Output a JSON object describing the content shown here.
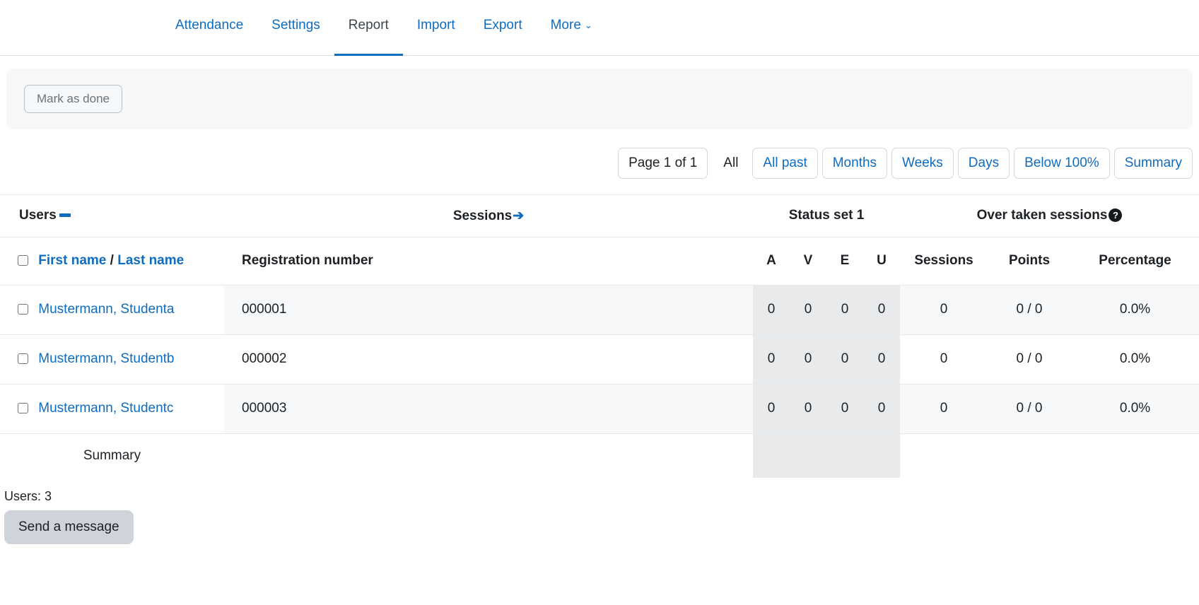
{
  "tabs": [
    {
      "label": "Attendance",
      "active": false
    },
    {
      "label": "Settings",
      "active": false
    },
    {
      "label": "Report",
      "active": true
    },
    {
      "label": "Import",
      "active": false
    },
    {
      "label": "Export",
      "active": false
    },
    {
      "label": "More",
      "active": false,
      "caret": "⌄"
    }
  ],
  "completion": {
    "mark_done_label": "Mark as done"
  },
  "controls": {
    "page_label": "Page 1 of 1",
    "all_label": "All",
    "filters": [
      "All past",
      "Months",
      "Weeks",
      "Days",
      "Below 100%",
      "Summary"
    ]
  },
  "table": {
    "groups": {
      "users": "Users",
      "users_icon": "minus-collapse-icon",
      "sessions": "Sessions",
      "sessions_icon": "arrow-right-icon",
      "status_set": "Status set 1",
      "over_taken": "Over taken sessions",
      "over_taken_icon": "help-icon",
      "help_glyph": "?",
      "arrow_glyph": "➔"
    },
    "headers": {
      "first_name": "First name",
      "separator": "/",
      "last_name": "Last name",
      "registration": "Registration number",
      "status_a": "A",
      "status_v": "V",
      "status_e": "E",
      "status_u": "U",
      "sessions": "Sessions",
      "points": "Points",
      "percentage": "Percentage"
    },
    "rows": [
      {
        "name": "Mustermann, Studenta",
        "registration": "000001",
        "a": "0",
        "v": "0",
        "e": "0",
        "u": "0",
        "sessions": "0",
        "points": "0 / 0",
        "percentage": "0.0%"
      },
      {
        "name": "Mustermann, Studentb",
        "registration": "000002",
        "a": "0",
        "v": "0",
        "e": "0",
        "u": "0",
        "sessions": "0",
        "points": "0 / 0",
        "percentage": "0.0%"
      },
      {
        "name": "Mustermann, Studentc",
        "registration": "000003",
        "a": "0",
        "v": "0",
        "e": "0",
        "u": "0",
        "sessions": "0",
        "points": "0 / 0",
        "percentage": "0.0%"
      }
    ],
    "summary_label": "Summary"
  },
  "footer": {
    "users_count": "Users: 3",
    "send_message_label": "Send a message"
  },
  "colors": {
    "link": "#0f6cbf",
    "text": "#1d2125",
    "panel": "#f7f8f9",
    "stat_shade": "#e9eaeb",
    "button": "#ced4da"
  }
}
